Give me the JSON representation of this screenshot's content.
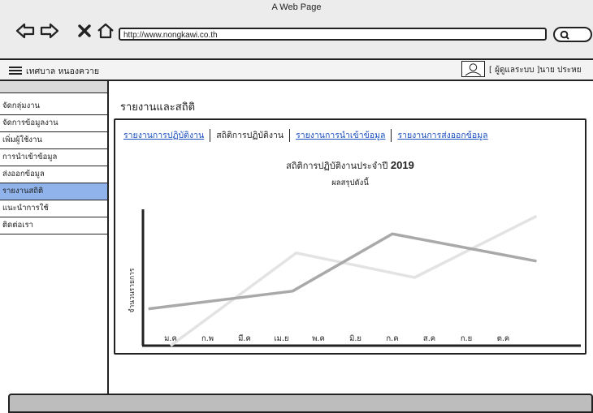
{
  "window": {
    "title": "A Web Page",
    "url": "http://www.nongkawi.co.th"
  },
  "header": {
    "org_name": "เทศบาล หนองควาย",
    "user_role": "[ ผู้ดูแลระบบ ]",
    "user_name": "นาย ประหย"
  },
  "sidebar": {
    "items": [
      {
        "label": "จัดกลุ่มงาน"
      },
      {
        "label": "จัดการข้อมูลงาน"
      },
      {
        "label": "เพิ่มผู้ใช้งาน"
      },
      {
        "label": "การนำเข้าข้อมูล"
      },
      {
        "label": "ส่งออกข้อมูล"
      },
      {
        "label": "รายงานสถิติ",
        "active": true
      },
      {
        "label": "แนะนำการใช้"
      },
      {
        "label": "ติดต่อเรา"
      }
    ]
  },
  "main": {
    "title": "รายงานและสถิติ",
    "tabs": [
      {
        "label": "รายงานการปฏิบัติงาน",
        "link": true
      },
      {
        "label": "สถิติการปฏิบัติงาน",
        "link": false
      },
      {
        "label": "รายงานการนำเข้าข้อมูล",
        "link": true
      },
      {
        "label": "รายงานการส่งออกข้อมูล",
        "link": true
      }
    ]
  },
  "chart_data": {
    "type": "line",
    "title": "สถิติการปฏิบัติงานประจำปี",
    "title_year": "2019",
    "subtitle": "ผลสรุปดังนี้",
    "ylabel": "จำนวนรายการ",
    "xlabel": "",
    "categories": [
      "ม.ค",
      "ก.พ",
      "มี.ค",
      "เม.ย",
      "พ.ค",
      "มิ.ย",
      "ก.ค",
      "ส.ค",
      "ก.ย",
      "ต.ค"
    ],
    "ylim": [
      0,
      100
    ],
    "grid": false,
    "series": [
      {
        "color": "#e3e3e3",
        "x": [
          0,
          3.4,
          6.6,
          9.9
        ],
        "values": [
          0,
          68,
          50,
          95
        ]
      },
      {
        "color": "#a9a9a9",
        "x": [
          -0.6,
          3.3,
          6.0,
          9.9
        ],
        "values": [
          27,
          40,
          82,
          62
        ]
      }
    ]
  }
}
